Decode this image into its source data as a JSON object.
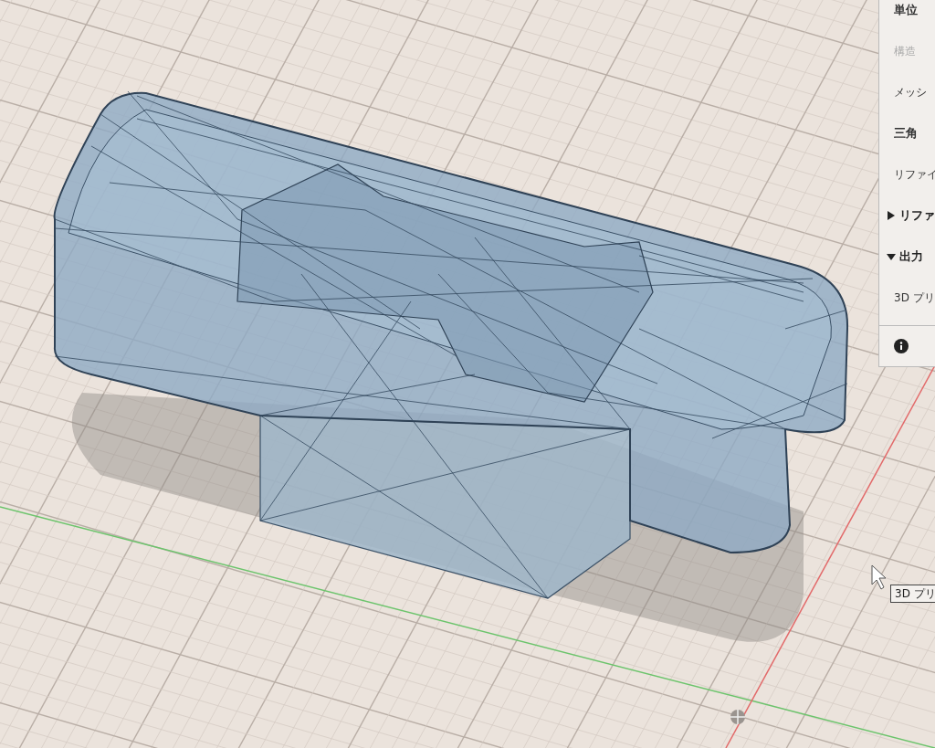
{
  "panel": {
    "rows": [
      {
        "kind": "heading",
        "text": "単位",
        "disabled": false
      },
      {
        "kind": "item",
        "text": "構造",
        "disabled": true
      },
      {
        "kind": "item",
        "text": "メッシ",
        "disabled": false
      },
      {
        "kind": "heading",
        "text": "三角",
        "disabled": false
      },
      {
        "kind": "item",
        "text": "リファイ",
        "disabled": false
      },
      {
        "kind": "section",
        "text": "リファ",
        "expanded": false
      },
      {
        "kind": "section",
        "text": "出力",
        "expanded": true
      },
      {
        "kind": "item",
        "text": "3D プリ",
        "disabled": false
      }
    ]
  },
  "tooltip": {
    "text": "3D プリ"
  }
}
